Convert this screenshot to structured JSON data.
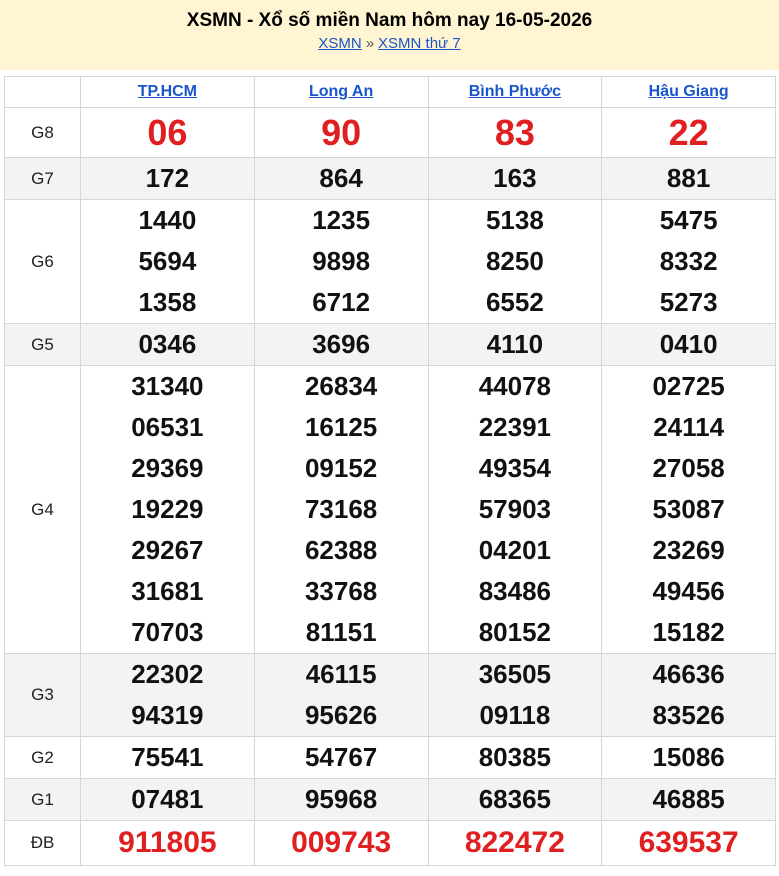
{
  "header": {
    "title": "XSMN - Xổ số miền Nam hôm nay 16-05-2026",
    "breadcrumb": [
      {
        "label": "XSMN"
      },
      {
        "label": "XSMN thứ 7"
      }
    ],
    "separator": "»"
  },
  "colors": {
    "header_bg": "#fff5d2",
    "link": "#1a55c9",
    "special_red": "#e02020",
    "alt_row": "#f3f3f3"
  },
  "provinces": [
    "TP.HCM",
    "Long An",
    "Bình Phước",
    "Hậu Giang"
  ],
  "prizes": [
    {
      "label": "G8",
      "key": "g8",
      "red": true,
      "alt": false,
      "values": [
        [
          "06"
        ],
        [
          "90"
        ],
        [
          "83"
        ],
        [
          "22"
        ]
      ]
    },
    {
      "label": "G7",
      "key": "g7",
      "red": false,
      "alt": true,
      "values": [
        [
          "172"
        ],
        [
          "864"
        ],
        [
          "163"
        ],
        [
          "881"
        ]
      ]
    },
    {
      "label": "G6",
      "key": "g6",
      "red": false,
      "alt": false,
      "values": [
        [
          "1440",
          "5694",
          "1358"
        ],
        [
          "1235",
          "9898",
          "6712"
        ],
        [
          "5138",
          "8250",
          "6552"
        ],
        [
          "5475",
          "8332",
          "5273"
        ]
      ]
    },
    {
      "label": "G5",
      "key": "g5",
      "red": false,
      "alt": true,
      "values": [
        [
          "0346"
        ],
        [
          "3696"
        ],
        [
          "4110"
        ],
        [
          "0410"
        ]
      ]
    },
    {
      "label": "G4",
      "key": "g4",
      "red": false,
      "alt": false,
      "values": [
        [
          "31340",
          "06531",
          "29369",
          "19229",
          "29267",
          "31681",
          "70703"
        ],
        [
          "26834",
          "16125",
          "09152",
          "73168",
          "62388",
          "33768",
          "81151"
        ],
        [
          "44078",
          "22391",
          "49354",
          "57903",
          "04201",
          "83486",
          "80152"
        ],
        [
          "02725",
          "24114",
          "27058",
          "53087",
          "23269",
          "49456",
          "15182"
        ]
      ]
    },
    {
      "label": "G3",
      "key": "g3",
      "red": false,
      "alt": true,
      "values": [
        [
          "22302",
          "94319"
        ],
        [
          "46115",
          "95626"
        ],
        [
          "36505",
          "09118"
        ],
        [
          "46636",
          "83526"
        ]
      ]
    },
    {
      "label": "G2",
      "key": "g2",
      "red": false,
      "alt": false,
      "values": [
        [
          "75541"
        ],
        [
          "54767"
        ],
        [
          "80385"
        ],
        [
          "15086"
        ]
      ]
    },
    {
      "label": "G1",
      "key": "g1",
      "red": false,
      "alt": true,
      "values": [
        [
          "07481"
        ],
        [
          "95968"
        ],
        [
          "68365"
        ],
        [
          "46885"
        ]
      ]
    },
    {
      "label": "ĐB",
      "key": "db",
      "red": true,
      "alt": false,
      "values": [
        [
          "911805"
        ],
        [
          "009743"
        ],
        [
          "822472"
        ],
        [
          "639537"
        ]
      ]
    }
  ]
}
